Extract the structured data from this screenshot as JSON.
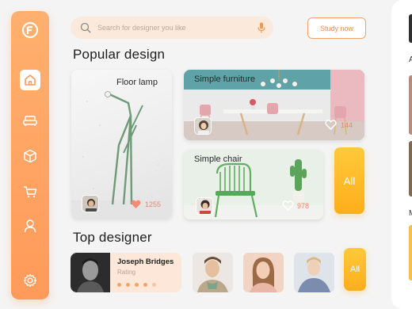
{
  "sidebar": {
    "items": [
      {
        "icon": "logo-icon"
      },
      {
        "icon": "home-icon",
        "active": true
      },
      {
        "icon": "sofa-icon"
      },
      {
        "icon": "cube-icon"
      },
      {
        "icon": "cart-icon"
      },
      {
        "icon": "user-icon"
      },
      {
        "icon": "settings-icon"
      }
    ]
  },
  "search": {
    "placeholder": "Search for designer you like",
    "icon": "search-icon",
    "mic_icon": "microphone-icon"
  },
  "header": {
    "study_label": "Study now"
  },
  "popular": {
    "title": "Popular design",
    "cards": [
      {
        "title": "Floor lamp",
        "count": "1255"
      },
      {
        "title": "Simple furniture",
        "count": "144"
      },
      {
        "title": "Simple chair",
        "count": "978"
      }
    ],
    "all_label": "All"
  },
  "designers": {
    "title": "Top designer",
    "featured": {
      "name": "Joseph Bridges",
      "role": "Rating",
      "rating": 5
    },
    "all_label": "All"
  },
  "right_panel": {
    "letters": [
      "A",
      "M"
    ]
  },
  "colors": {
    "accent": "#ff9a5a",
    "yellow": "#ffae1c",
    "background": "#f4f4f4"
  }
}
